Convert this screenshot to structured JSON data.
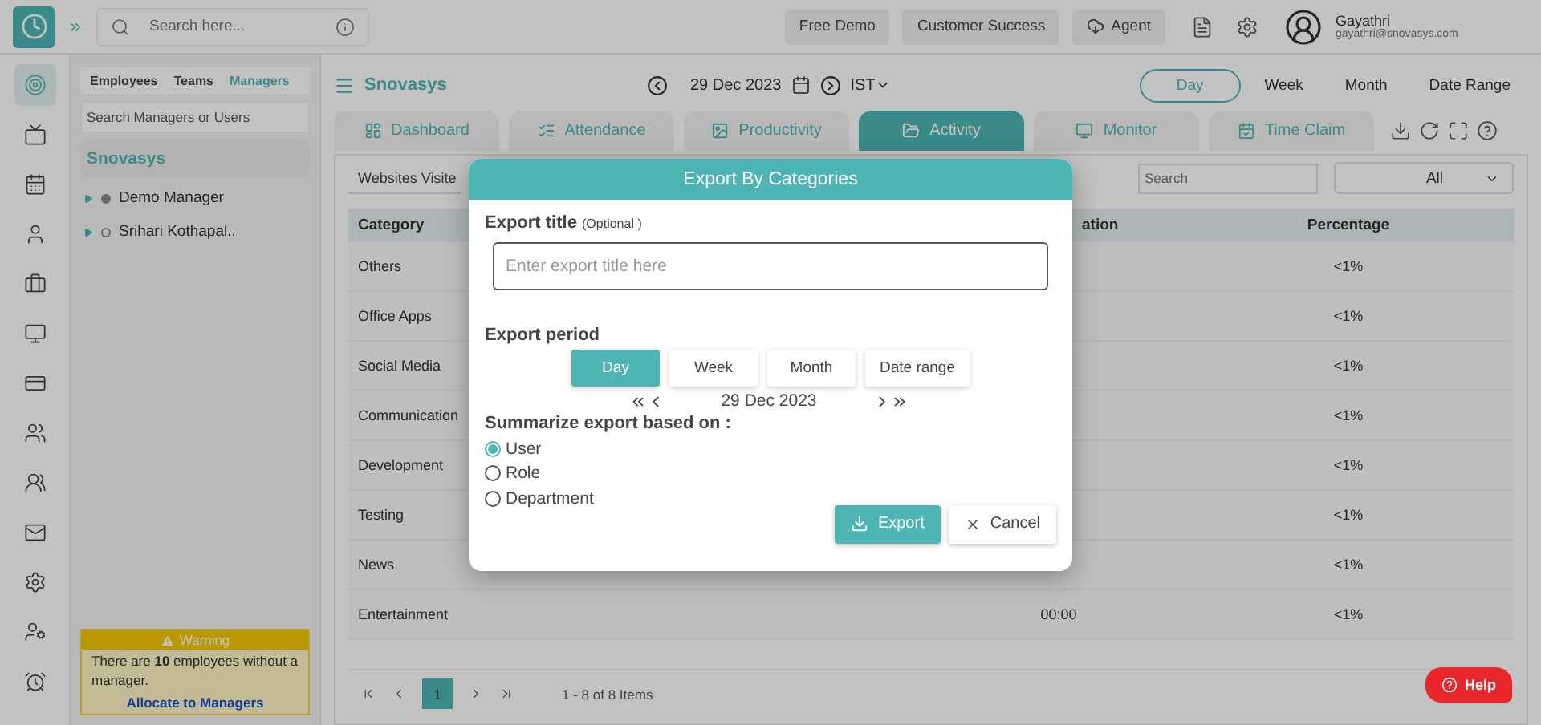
{
  "topbar": {
    "search_placeholder": "Search here...",
    "buttons": [
      {
        "label": "Free Demo",
        "kind": "plain"
      },
      {
        "label": "Customer Success",
        "kind": "plain"
      },
      {
        "label": "Agent",
        "kind": "agent"
      }
    ],
    "user_name": "Gayathri",
    "user_email": "gayathri@snovasys.com"
  },
  "rail_items": [
    {
      "selected": true
    },
    {
      "selected": false
    },
    {
      "selected": false
    },
    {
      "selected": false
    },
    {
      "selected": false
    },
    {
      "selected": false
    },
    {
      "selected": false
    },
    {
      "selected": false
    },
    {
      "selected": false
    },
    {
      "selected": false
    },
    {
      "selected": false
    },
    {
      "selected": false
    },
    {
      "selected": false
    }
  ],
  "manager_panel": {
    "tabs": [
      {
        "label": "Employees",
        "selected": false
      },
      {
        "label": "Teams",
        "selected": false
      },
      {
        "label": "Managers",
        "selected": true
      }
    ],
    "search_placeholder": "Search Managers or Users",
    "org": "Snovasys",
    "managers": [
      {
        "name": "Demo Manager",
        "active": true
      },
      {
        "name": "Srihari Kothapal..",
        "active": false
      }
    ],
    "warning": {
      "title": "Warning",
      "text": "There are **10** employees without a manager.",
      "link": "Allocate to Managers"
    }
  },
  "header": {
    "org": "Snovasys",
    "date": "29 Dec 2023",
    "timezone": "IST",
    "periods": [
      {
        "label": "Day",
        "selected": true
      },
      {
        "label": "Week",
        "selected": false
      },
      {
        "label": "Month",
        "selected": false
      },
      {
        "label": "Date Range",
        "selected": false
      }
    ]
  },
  "nav_tabs": [
    {
      "label": "Dashboard",
      "selected": false
    },
    {
      "label": "Attendance",
      "selected": false
    },
    {
      "label": "Productivity",
      "selected": false
    },
    {
      "label": "Activity",
      "selected": true
    },
    {
      "label": "Monitor",
      "selected": false
    },
    {
      "label": "Time Claim",
      "selected": false
    }
  ],
  "content": {
    "subtab": "Websites Visite",
    "search_placeholder": "Search",
    "filter": "All",
    "columns": [
      "Category",
      "ation",
      "Percentage"
    ],
    "rows": [
      {
        "category": "Others",
        "percentage": "<1%"
      },
      {
        "category": "Office Apps",
        "percentage": "<1%"
      },
      {
        "category": "Social Media",
        "percentage": "<1%"
      },
      {
        "category": "Communication",
        "percentage": "<1%"
      },
      {
        "category": "Development",
        "percentage": "<1%"
      },
      {
        "category": "Testing",
        "percentage": "<1%"
      },
      {
        "category": "News",
        "percentage": "<1%"
      },
      {
        "category": "Entertainment",
        "duration": "00:00",
        "percentage": "<1%"
      }
    ],
    "page": "1",
    "page_info": "1 - 8 of 8 Items"
  },
  "help": "Help",
  "modal": {
    "title": "Export By Categories",
    "title_label": "Export title",
    "optional": "(Optional )",
    "title_placeholder": "Enter export title here",
    "period_label": "Export period",
    "periods": [
      {
        "label": "Day",
        "selected": true
      },
      {
        "label": "Week",
        "selected": false
      },
      {
        "label": "Month",
        "selected": false
      },
      {
        "label": "Date range",
        "selected": false
      }
    ],
    "date": "29 Dec 2023",
    "summarize_label": "Summarize export based on :",
    "options": [
      {
        "label": "User",
        "selected": true
      },
      {
        "label": "Role",
        "selected": false
      },
      {
        "label": "Department",
        "selected": false
      }
    ],
    "export": "Export",
    "cancel": "Cancel"
  }
}
